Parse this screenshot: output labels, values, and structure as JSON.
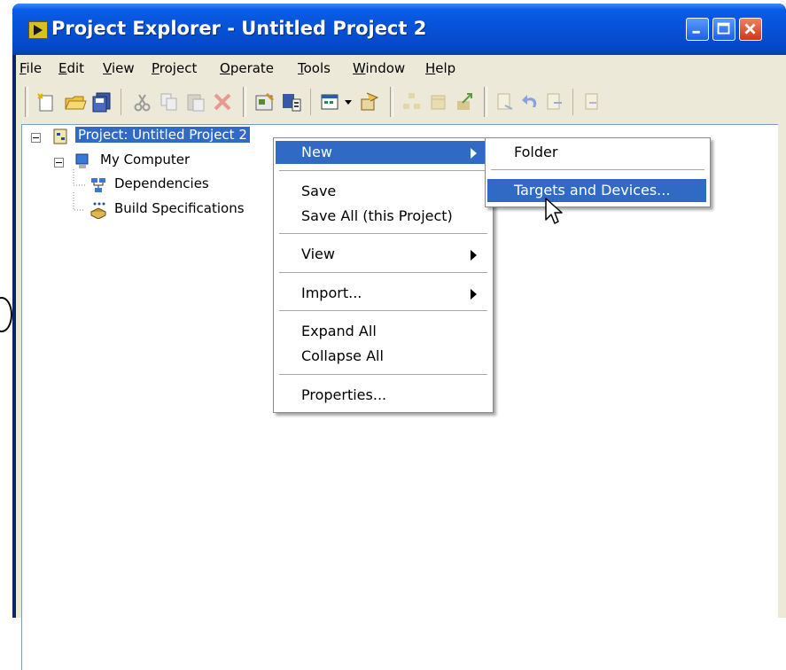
{
  "window": {
    "title": "Project Explorer - Untitled Project 2"
  },
  "menubar": {
    "items": [
      {
        "label": "File",
        "key": "F",
        "rest": "ile"
      },
      {
        "label": "Edit",
        "key": "E",
        "rest": "dit"
      },
      {
        "label": "View",
        "key": "V",
        "rest": "iew"
      },
      {
        "label": "Project",
        "key": "P",
        "rest": "roject"
      },
      {
        "label": "Operate",
        "key": "O",
        "rest": "perate"
      },
      {
        "label": "Tools",
        "key": "T",
        "rest": "ools"
      },
      {
        "label": "Window",
        "key": "W",
        "rest": "indow"
      },
      {
        "label": "Help",
        "key": "H",
        "rest": "elp"
      }
    ]
  },
  "tree": {
    "root": "Project: Untitled Project 2",
    "computer": "My Computer",
    "dependencies": "Dependencies",
    "build_specs": "Build Specifications"
  },
  "context_menu": {
    "new": "New",
    "save": "Save",
    "save_all": "Save All (this Project)",
    "view": "View",
    "import": "Import...",
    "expand_all": "Expand All",
    "collapse_all": "Collapse All",
    "properties": "Properties..."
  },
  "submenu": {
    "folder": "Folder",
    "targets": "Targets and Devices..."
  },
  "colors": {
    "titlebar": "#0651d6",
    "highlight": "#316ac5",
    "chrome": "#ece9d8"
  }
}
